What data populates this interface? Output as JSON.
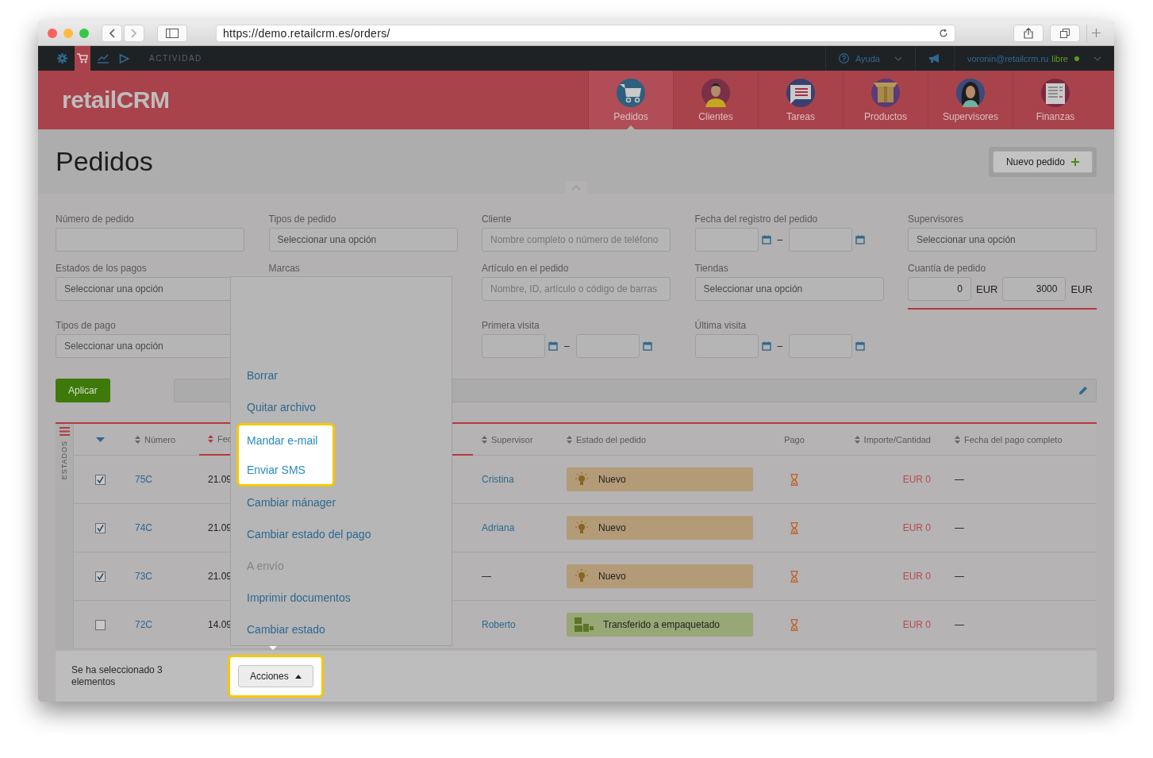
{
  "browser": {
    "url": "https://demo.retailcrm.es/orders/"
  },
  "topbar": {
    "icons": [
      {
        "kind": "gear",
        "selected": false
      },
      {
        "kind": "cart",
        "selected": true
      },
      {
        "kind": "chart",
        "selected": false
      },
      {
        "kind": "play",
        "selected": false
      }
    ],
    "activity": "ACTIVIDAD",
    "help": "Ayuda",
    "user": "voronin@retailcrm.ru",
    "plan": "libre"
  },
  "logo": "retailCRM",
  "nav": [
    {
      "label": "Pedidos",
      "kind": "cart",
      "selected": true
    },
    {
      "label": "Clientes",
      "kind": "man",
      "selected": false
    },
    {
      "label": "Tareas",
      "kind": "chat",
      "selected": false
    },
    {
      "label": "Productos",
      "kind": "box",
      "selected": false
    },
    {
      "label": "Supervisores",
      "kind": "woman",
      "selected": false
    },
    {
      "label": "Finanzas",
      "kind": "ledger",
      "selected": false
    }
  ],
  "page": {
    "title": "Pedidos",
    "new_button": "Nuevo pedido"
  },
  "filters": [
    {
      "label": "Número de pedido",
      "kind": "text"
    },
    {
      "label": "Tipos de pedido",
      "kind": "select",
      "value": "Seleccionar una opción"
    },
    {
      "label": "Cliente",
      "kind": "text",
      "placeholder": "Nombre completo o número de teléfono"
    },
    {
      "label": "Fecha del registro del pedido",
      "kind": "date_range",
      "separator": "–"
    },
    {
      "label": "Supervisores",
      "kind": "select",
      "value": "Seleccionar una opción"
    },
    {
      "label": "Estados de los pagos",
      "kind": "select",
      "value": "Seleccionar una opción"
    },
    {
      "label": "Marcas",
      "kind": "label_only"
    },
    {
      "label": "Artículo en el pedido",
      "kind": "text",
      "placeholder": "Nombre, ID, artículo o código de barras"
    },
    {
      "label": "Tiendas",
      "kind": "select",
      "value": "Seleccionar una opción"
    },
    {
      "label": "Cuantía de pedido",
      "kind": "amount",
      "min": "0",
      "min_currency": "EUR",
      "max": "3000",
      "max_currency": "EUR"
    },
    {
      "label": "Tipos de pago",
      "kind": "select",
      "value": "Seleccionar una opción"
    },
    {
      "kind": "blank"
    },
    {
      "label": "Primera visita",
      "kind": "date_range",
      "separator": "–"
    },
    {
      "label": "Última visita",
      "kind": "date_range",
      "separator": "–"
    },
    {
      "kind": "blank"
    }
  ],
  "apply_button": "Aplicar",
  "table": {
    "side_label": "ESTADOS",
    "columns": [
      {
        "label": "Número",
        "sorted": false
      },
      {
        "label": "Fec",
        "sorted": true
      },
      {
        "label": "Supervisor",
        "sorted": false
      },
      {
        "label": "Estado del pedido",
        "sorted": false
      },
      {
        "label": "Pago",
        "kind": "plain"
      },
      {
        "label": "Importe/Cantidad",
        "sorted": false
      },
      {
        "label": "Fecha del pago completo",
        "sorted": false
      }
    ],
    "rows": [
      {
        "checked": true,
        "number": "75C",
        "date": "21.09",
        "supervisor": "Cristina",
        "linked": true,
        "status": {
          "label": "Nuevo",
          "kind": "new"
        },
        "amount": "EUR 0",
        "paid_date": "—"
      },
      {
        "checked": true,
        "number": "74C",
        "date": "21.09",
        "supervisor": "Adriana",
        "linked": true,
        "status": {
          "label": "Nuevo",
          "kind": "new"
        },
        "amount": "EUR 0",
        "paid_date": "—"
      },
      {
        "checked": true,
        "number": "73C",
        "date": "21.09",
        "supervisor": "—",
        "linked": false,
        "status": {
          "label": "Nuevo",
          "kind": "new"
        },
        "amount": "EUR 0",
        "paid_date": "—"
      },
      {
        "checked": false,
        "number": "72C",
        "date": "14.09",
        "supervisor": "Roberto",
        "linked": true,
        "status": {
          "label": "Transferido a empaquetado",
          "kind": "packing"
        },
        "amount": "EUR 0",
        "paid_date": "—"
      }
    ]
  },
  "selection": {
    "text": "Se ha seleccionado 3 elementos",
    "actions_button": "Acciones",
    "highlighted": true
  },
  "menu": [
    {
      "label": "Borrar",
      "disabled": false,
      "highlighted": false
    },
    {
      "label": "Quitar archivo",
      "disabled": false,
      "highlighted": false
    },
    {
      "label": "Mandar e-mail",
      "disabled": false,
      "highlighted": true
    },
    {
      "label": "Enviar SMS",
      "disabled": false,
      "highlighted": true
    },
    {
      "label": "Cambiar mánager",
      "disabled": false,
      "highlighted": false
    },
    {
      "label": "Cambiar estado del pago",
      "disabled": false,
      "highlighted": false
    },
    {
      "label": "A envío",
      "disabled": true,
      "highlighted": false
    },
    {
      "label": "Imprimir documentos",
      "disabled": false,
      "highlighted": false
    },
    {
      "label": "Cambiar estado",
      "disabled": false,
      "highlighted": false
    }
  ]
}
